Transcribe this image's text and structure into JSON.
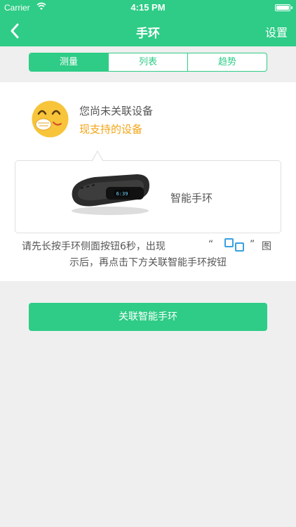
{
  "status_bar": {
    "carrier": "Carrier",
    "time": "4:15 PM"
  },
  "nav": {
    "title": "手环",
    "settings_label": "设置",
    "back_icon": "chevron-left-icon"
  },
  "tabs": [
    {
      "label": "测量",
      "active": true
    },
    {
      "label": "列表",
      "active": false
    },
    {
      "label": "趋势",
      "active": false
    }
  ],
  "device_status": {
    "not_linked_text": "您尚未关联设备",
    "supported_devices_link": "现支持的设备"
  },
  "device": {
    "name": "智能手环",
    "screen_time": "6:39"
  },
  "instructions": {
    "part1": "请先长按手环侧面按钮6秒，出现",
    "open_quote": "“",
    "close_quote": "”",
    "part2": "图",
    "line2": "示后，再点击下方关联智能手环按钮"
  },
  "pair_button_label": "关联智能手环",
  "colors": {
    "brand_green": "#2ecc86",
    "link_orange": "#f2a516",
    "background": "#efefef",
    "pair_icon_blue": "#3aa0e0"
  }
}
